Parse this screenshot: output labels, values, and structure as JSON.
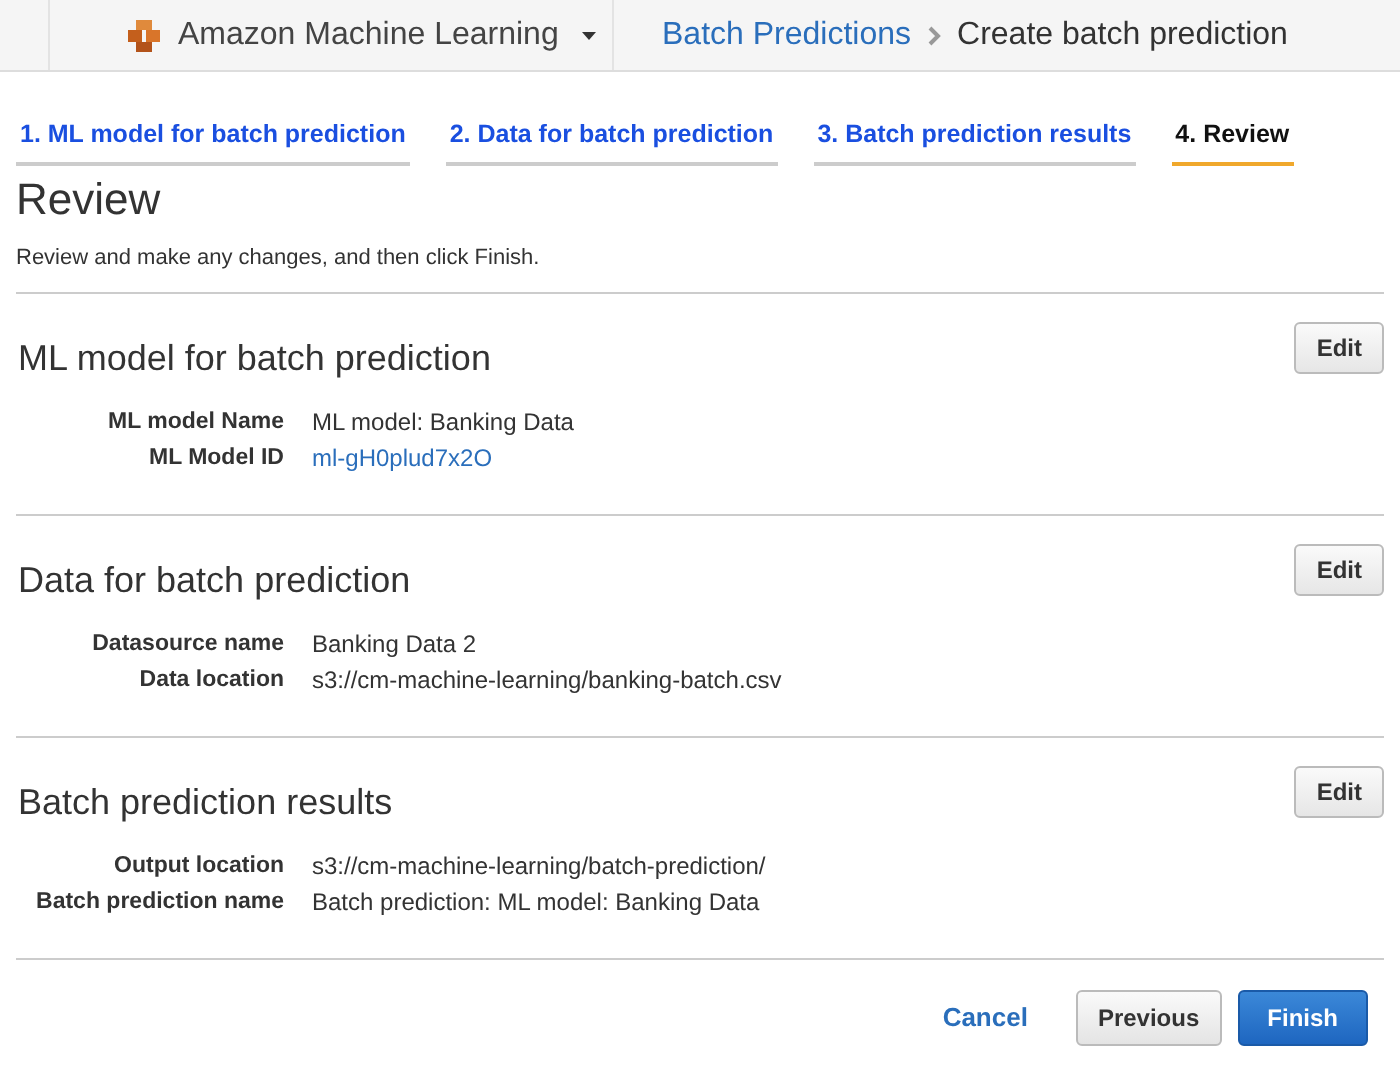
{
  "header": {
    "service": "Amazon Machine Learning",
    "breadcrumb": [
      {
        "label": "Batch Predictions",
        "kind": "link"
      },
      {
        "label": "Create batch prediction",
        "kind": "text"
      }
    ]
  },
  "steps": [
    {
      "label": "1. ML model for batch prediction",
      "selected": false
    },
    {
      "label": "2. Data for batch prediction",
      "selected": false
    },
    {
      "label": "3. Batch prediction results",
      "selected": false
    },
    {
      "label": "4. Review",
      "selected": true
    }
  ],
  "page": {
    "title": "Review",
    "description": "Review and make any changes, and then click Finish."
  },
  "sections": [
    {
      "title": "ML model for batch prediction",
      "edit": "Edit",
      "fields": [
        {
          "label": "ML model Name",
          "value": "ML model: Banking Data",
          "kind": "text"
        },
        {
          "label": "ML Model ID",
          "value": "ml-gH0plud7x2O",
          "kind": "link"
        }
      ]
    },
    {
      "title": "Data for batch prediction",
      "edit": "Edit",
      "fields": [
        {
          "label": "Datasource name",
          "value": "Banking Data 2",
          "kind": "text"
        },
        {
          "label": "Data location",
          "value": "s3://cm-machine-learning/banking-batch.csv",
          "kind": "text"
        }
      ]
    },
    {
      "title": "Batch prediction results",
      "edit": "Edit",
      "fields": [
        {
          "label": "Output location",
          "value": "s3://cm-machine-learning/batch-prediction/",
          "kind": "text"
        },
        {
          "label": "Batch prediction name",
          "value": "Batch prediction: ML model: Banking Data",
          "kind": "text"
        }
      ]
    }
  ],
  "footer": {
    "cancel": "Cancel",
    "previous": "Previous",
    "finish": "Finish"
  }
}
